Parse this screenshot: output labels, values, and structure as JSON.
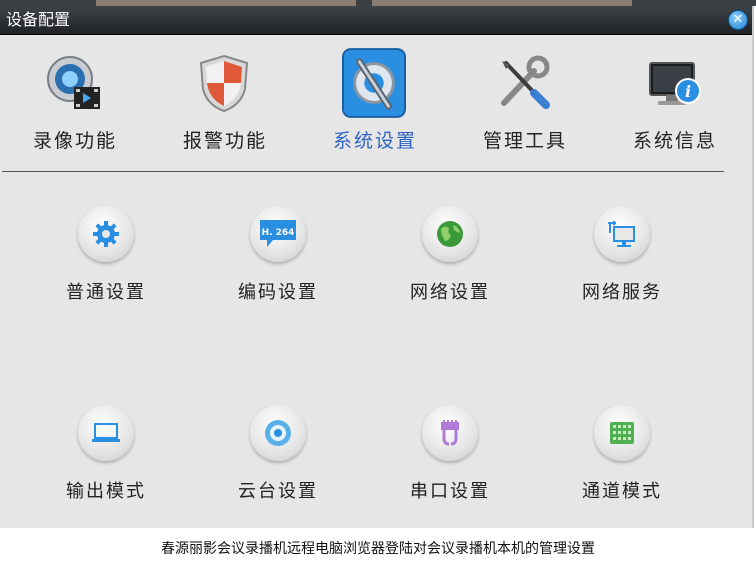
{
  "window": {
    "title": "设备配置"
  },
  "main_tabs": [
    {
      "label": "录像功能",
      "icon": "video-record-icon"
    },
    {
      "label": "报警功能",
      "icon": "alarm-shield-icon"
    },
    {
      "label": "系统设置",
      "icon": "system-settings-icon",
      "active": true
    },
    {
      "label": "管理工具",
      "icon": "tools-icon"
    },
    {
      "label": "系统信息",
      "icon": "system-info-icon"
    }
  ],
  "sub_items": [
    {
      "label": "普通设置",
      "icon": "gear-icon"
    },
    {
      "label": "编码设置",
      "icon": "h264-encode-icon",
      "badge": "H. 264"
    },
    {
      "label": "网络设置",
      "icon": "globe-icon"
    },
    {
      "label": "网络服务",
      "icon": "network-service-icon"
    },
    {
      "label": "输出模式",
      "icon": "monitor-output-icon"
    },
    {
      "label": "云台设置",
      "icon": "ptz-icon"
    },
    {
      "label": "串口设置",
      "icon": "serial-port-icon"
    },
    {
      "label": "通道模式",
      "icon": "channel-grid-icon"
    }
  ],
  "caption": "春源丽影会议录播机远程电脑浏览器登陆对会议录播机本机的管理设置",
  "colors": {
    "titlebar": "#2a2e33",
    "panel": "#e6e6e6",
    "active_label": "#2f63c4",
    "icon_blue": "#2a8fe0"
  }
}
